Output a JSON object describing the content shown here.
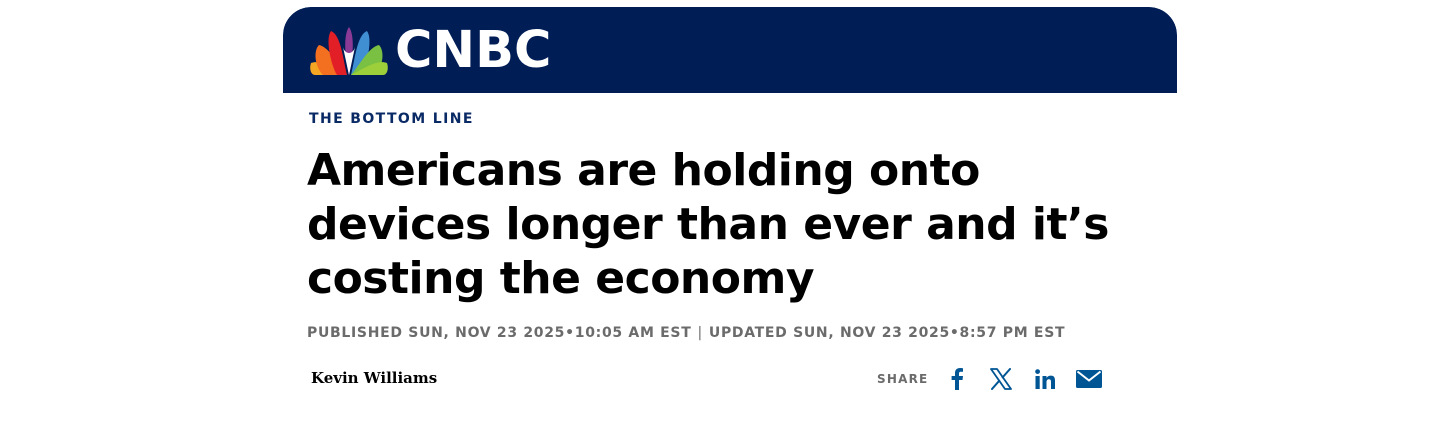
{
  "brand": {
    "name": "CNBC",
    "header_color": "#011d56",
    "accent_color": "#0a2a66",
    "share_icon_color": "#005594"
  },
  "article": {
    "kicker": "THE BOTTOM LINE",
    "headline": "Americans are holding onto devices longer than ever and it’s costing the economy",
    "published": "PUBLISHED SUN, NOV 23 2025•10:05 AM EST",
    "separator": "|",
    "updated": "UPDATED SUN, NOV 23 2025•8:57 PM EST",
    "author": "Kevin Williams"
  },
  "share": {
    "label": "SHARE",
    "buttons": [
      {
        "icon": "facebook-icon"
      },
      {
        "icon": "x-icon"
      },
      {
        "icon": "linkedin-icon"
      },
      {
        "icon": "email-icon"
      }
    ]
  }
}
